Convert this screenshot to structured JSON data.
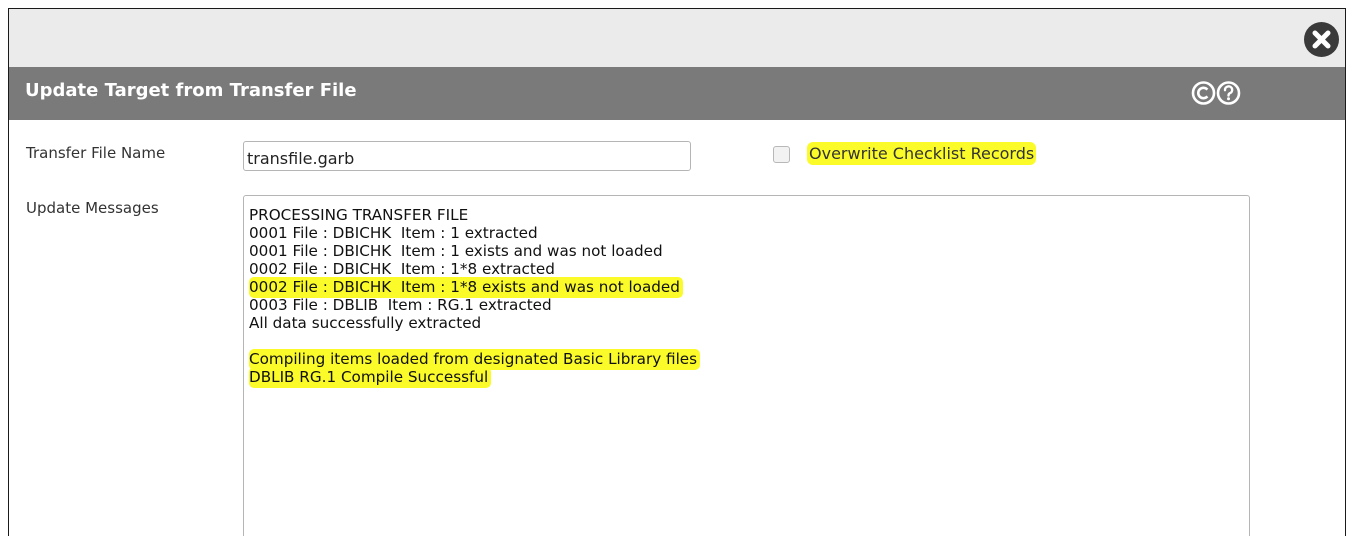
{
  "dialog": {
    "title": "Update Target from Transfer File",
    "close_icon": "close-circle-icon",
    "title_icons": [
      "copyright-icon",
      "help-icon"
    ]
  },
  "form": {
    "transfer_file_label": "Transfer File Name",
    "transfer_file_value": "transfile.garb",
    "overwrite_checkbox_label": "Overwrite Checklist Records",
    "overwrite_checked": false,
    "update_messages_label": "Update Messages"
  },
  "messages": [
    {
      "text": "PROCESSING TRANSFER FILE",
      "highlighted": false
    },
    {
      "text": "0001 File : DBICHK  Item : 1 extracted",
      "highlighted": false
    },
    {
      "text": "0001 File : DBICHK  Item : 1 exists and was not loaded",
      "highlighted": false
    },
    {
      "text": "0002 File : DBICHK  Item : 1*8 extracted",
      "highlighted": false
    },
    {
      "text": "0002 File : DBICHK  Item : 1*8 exists and was not loaded",
      "highlighted": true
    },
    {
      "text": "0003 File : DBLIB  Item : RG.1 extracted",
      "highlighted": false
    },
    {
      "text": "All data successfully extracted",
      "highlighted": false
    },
    {
      "text": "",
      "highlighted": false
    },
    {
      "text": "Compiling items loaded from designated Basic Library files",
      "highlighted": true
    },
    {
      "text": "DBLIB RG.1 Compile Successful",
      "highlighted": true
    }
  ],
  "colors": {
    "title_bar": "#7a7a7a",
    "top_bar": "#ebebeb",
    "highlight": "#fbfb2a"
  }
}
